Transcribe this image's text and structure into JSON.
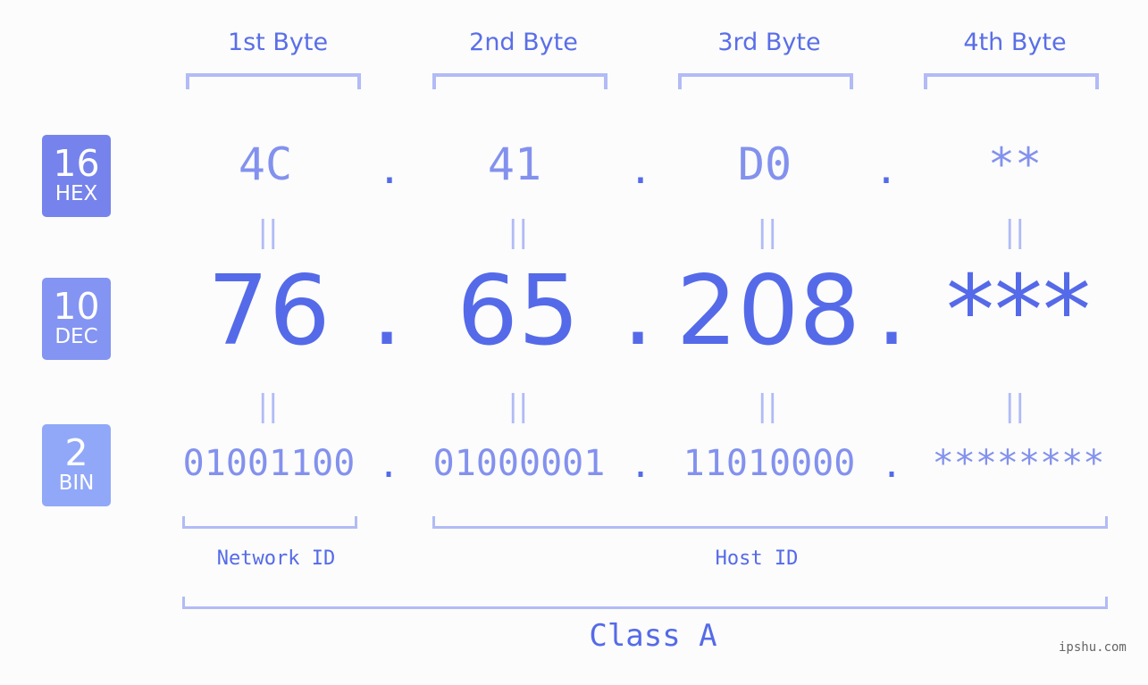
{
  "headers": [
    "1st Byte",
    "2nd Byte",
    "3rd Byte",
    "4th Byte"
  ],
  "badges": {
    "hex": {
      "num": "16",
      "label": "HEX",
      "color": "#7683ec"
    },
    "dec": {
      "num": "10",
      "label": "DEC",
      "color": "#8494f2"
    },
    "bin": {
      "num": "2",
      "label": "BIN",
      "color": "#91a8f8"
    }
  },
  "hex": [
    "4C",
    "41",
    "D0",
    "**"
  ],
  "dec": [
    "76",
    "65",
    "208",
    "***"
  ],
  "bin": [
    "01001100",
    "01000001",
    "11010000",
    "********"
  ],
  "separator": ".",
  "equals": "||",
  "network_label": "Network ID",
  "host_label": "Host ID",
  "class_label": "Class A",
  "watermark": "ipshu.com"
}
